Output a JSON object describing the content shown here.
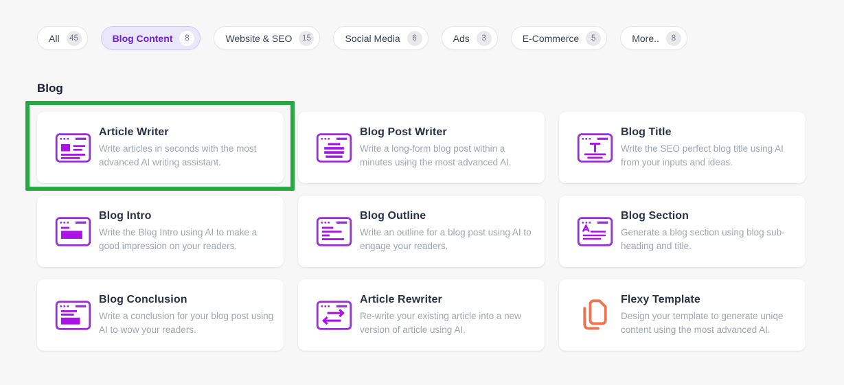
{
  "tabs": [
    {
      "label": "All",
      "count": "45",
      "active": false
    },
    {
      "label": "Blog Content",
      "count": "8",
      "active": true
    },
    {
      "label": "Website & SEO",
      "count": "15",
      "active": false
    },
    {
      "label": "Social Media",
      "count": "6",
      "active": false
    },
    {
      "label": "Ads",
      "count": "3",
      "active": false
    },
    {
      "label": "E-Commerce",
      "count": "5",
      "active": false
    },
    {
      "label": "More..",
      "count": "8",
      "active": false
    }
  ],
  "section": {
    "title": "Blog"
  },
  "cards": [
    {
      "title": "Article Writer",
      "description": "Write articles in seconds with the most advanced AI writing assistant.",
      "icon": "article-writer-icon",
      "highlighted": true
    },
    {
      "title": "Blog Post Writer",
      "description": "Write a long-form blog post within a minutes using the most advanced AI.",
      "icon": "blog-post-writer-icon",
      "highlighted": false
    },
    {
      "title": "Blog Title",
      "description": "Write the SEO perfect blog title using AI from your inputs and ideas.",
      "icon": "blog-title-icon",
      "highlighted": false
    },
    {
      "title": "Blog Intro",
      "description": "Write the Blog Intro using AI to make a good impression on your readers.",
      "icon": "blog-intro-icon",
      "highlighted": false
    },
    {
      "title": "Blog Outline",
      "description": "Write an outline for a blog post using AI to engage your readers.",
      "icon": "blog-outline-icon",
      "highlighted": false
    },
    {
      "title": "Blog Section",
      "description": "Generate a blog section using blog sub-heading and title.",
      "icon": "blog-section-icon",
      "highlighted": false
    },
    {
      "title": "Blog Conclusion",
      "description": "Write a conclusion for your blog post using AI to wow your readers.",
      "icon": "blog-conclusion-icon",
      "highlighted": false
    },
    {
      "title": "Article Rewriter",
      "description": "Re-write your existing article into a new version of article using AI.",
      "icon": "article-rewriter-icon",
      "highlighted": false
    },
    {
      "title": "Flexy Template",
      "description": "Design your template to generate uniqe content using the most advanced AI.",
      "icon": "flexy-template-icon",
      "highlighted": false
    }
  ],
  "colors": {
    "page_background": "#f7f7f8",
    "card_background": "#ffffff",
    "icon_purple_stroke": "#9632d2",
    "icon_purple_fill": "#a814e6",
    "icon_orange": "#ee7350",
    "active_tab_text": "#6b21d6",
    "active_tab_background": "#eae7fb",
    "annotation_green": "#26a944",
    "title_text": "#2a3147",
    "description_text": "#a1a5ae"
  }
}
